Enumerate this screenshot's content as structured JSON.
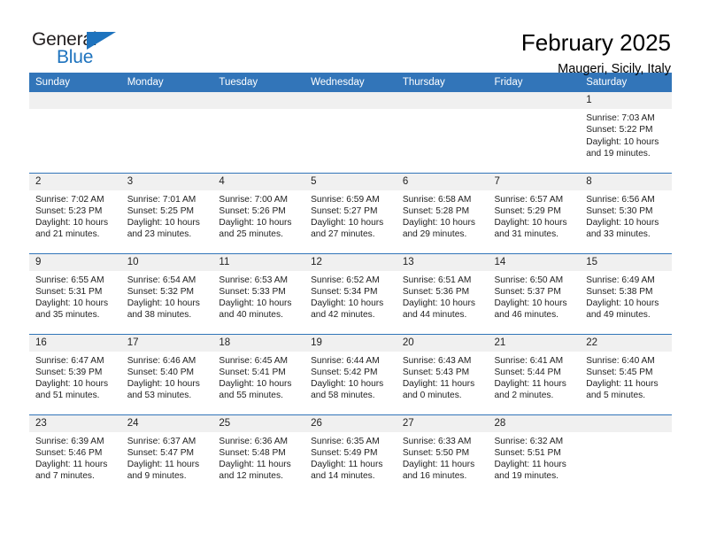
{
  "logo": {
    "primary_text": "General",
    "secondary_text": "Blue",
    "primary_color": "#231f20",
    "accent_color": "#1e73be",
    "triangle_icon": "triangle-icon"
  },
  "header": {
    "month_title": "February 2025",
    "location": "Maugeri, Sicily, Italy"
  },
  "theme": {
    "header_bg": "#3275b9",
    "header_text": "#ffffff",
    "daynum_bg": "#f0f0f0",
    "grid_line": "#3275b9",
    "body_text": "#222222"
  },
  "calendar": {
    "weekday_headers": [
      "Sunday",
      "Monday",
      "Tuesday",
      "Wednesday",
      "Thursday",
      "Friday",
      "Saturday"
    ],
    "weeks": [
      [
        {
          "day": "",
          "sunrise": "",
          "sunset": "",
          "daylight_line1": "",
          "daylight_line2": "",
          "empty": true
        },
        {
          "day": "",
          "sunrise": "",
          "sunset": "",
          "daylight_line1": "",
          "daylight_line2": "",
          "empty": true
        },
        {
          "day": "",
          "sunrise": "",
          "sunset": "",
          "daylight_line1": "",
          "daylight_line2": "",
          "empty": true
        },
        {
          "day": "",
          "sunrise": "",
          "sunset": "",
          "daylight_line1": "",
          "daylight_line2": "",
          "empty": true
        },
        {
          "day": "",
          "sunrise": "",
          "sunset": "",
          "daylight_line1": "",
          "daylight_line2": "",
          "empty": true
        },
        {
          "day": "",
          "sunrise": "",
          "sunset": "",
          "daylight_line1": "",
          "daylight_line2": "",
          "empty": true
        },
        {
          "day": "1",
          "sunrise": "Sunrise: 7:03 AM",
          "sunset": "Sunset: 5:22 PM",
          "daylight_line1": "Daylight: 10 hours",
          "daylight_line2": "and 19 minutes.",
          "empty": false
        }
      ],
      [
        {
          "day": "2",
          "sunrise": "Sunrise: 7:02 AM",
          "sunset": "Sunset: 5:23 PM",
          "daylight_line1": "Daylight: 10 hours",
          "daylight_line2": "and 21 minutes.",
          "empty": false
        },
        {
          "day": "3",
          "sunrise": "Sunrise: 7:01 AM",
          "sunset": "Sunset: 5:25 PM",
          "daylight_line1": "Daylight: 10 hours",
          "daylight_line2": "and 23 minutes.",
          "empty": false
        },
        {
          "day": "4",
          "sunrise": "Sunrise: 7:00 AM",
          "sunset": "Sunset: 5:26 PM",
          "daylight_line1": "Daylight: 10 hours",
          "daylight_line2": "and 25 minutes.",
          "empty": false
        },
        {
          "day": "5",
          "sunrise": "Sunrise: 6:59 AM",
          "sunset": "Sunset: 5:27 PM",
          "daylight_line1": "Daylight: 10 hours",
          "daylight_line2": "and 27 minutes.",
          "empty": false
        },
        {
          "day": "6",
          "sunrise": "Sunrise: 6:58 AM",
          "sunset": "Sunset: 5:28 PM",
          "daylight_line1": "Daylight: 10 hours",
          "daylight_line2": "and 29 minutes.",
          "empty": false
        },
        {
          "day": "7",
          "sunrise": "Sunrise: 6:57 AM",
          "sunset": "Sunset: 5:29 PM",
          "daylight_line1": "Daylight: 10 hours",
          "daylight_line2": "and 31 minutes.",
          "empty": false
        },
        {
          "day": "8",
          "sunrise": "Sunrise: 6:56 AM",
          "sunset": "Sunset: 5:30 PM",
          "daylight_line1": "Daylight: 10 hours",
          "daylight_line2": "and 33 minutes.",
          "empty": false
        }
      ],
      [
        {
          "day": "9",
          "sunrise": "Sunrise: 6:55 AM",
          "sunset": "Sunset: 5:31 PM",
          "daylight_line1": "Daylight: 10 hours",
          "daylight_line2": "and 35 minutes.",
          "empty": false
        },
        {
          "day": "10",
          "sunrise": "Sunrise: 6:54 AM",
          "sunset": "Sunset: 5:32 PM",
          "daylight_line1": "Daylight: 10 hours",
          "daylight_line2": "and 38 minutes.",
          "empty": false
        },
        {
          "day": "11",
          "sunrise": "Sunrise: 6:53 AM",
          "sunset": "Sunset: 5:33 PM",
          "daylight_line1": "Daylight: 10 hours",
          "daylight_line2": "and 40 minutes.",
          "empty": false
        },
        {
          "day": "12",
          "sunrise": "Sunrise: 6:52 AM",
          "sunset": "Sunset: 5:34 PM",
          "daylight_line1": "Daylight: 10 hours",
          "daylight_line2": "and 42 minutes.",
          "empty": false
        },
        {
          "day": "13",
          "sunrise": "Sunrise: 6:51 AM",
          "sunset": "Sunset: 5:36 PM",
          "daylight_line1": "Daylight: 10 hours",
          "daylight_line2": "and 44 minutes.",
          "empty": false
        },
        {
          "day": "14",
          "sunrise": "Sunrise: 6:50 AM",
          "sunset": "Sunset: 5:37 PM",
          "daylight_line1": "Daylight: 10 hours",
          "daylight_line2": "and 46 minutes.",
          "empty": false
        },
        {
          "day": "15",
          "sunrise": "Sunrise: 6:49 AM",
          "sunset": "Sunset: 5:38 PM",
          "daylight_line1": "Daylight: 10 hours",
          "daylight_line2": "and 49 minutes.",
          "empty": false
        }
      ],
      [
        {
          "day": "16",
          "sunrise": "Sunrise: 6:47 AM",
          "sunset": "Sunset: 5:39 PM",
          "daylight_line1": "Daylight: 10 hours",
          "daylight_line2": "and 51 minutes.",
          "empty": false
        },
        {
          "day": "17",
          "sunrise": "Sunrise: 6:46 AM",
          "sunset": "Sunset: 5:40 PM",
          "daylight_line1": "Daylight: 10 hours",
          "daylight_line2": "and 53 minutes.",
          "empty": false
        },
        {
          "day": "18",
          "sunrise": "Sunrise: 6:45 AM",
          "sunset": "Sunset: 5:41 PM",
          "daylight_line1": "Daylight: 10 hours",
          "daylight_line2": "and 55 minutes.",
          "empty": false
        },
        {
          "day": "19",
          "sunrise": "Sunrise: 6:44 AM",
          "sunset": "Sunset: 5:42 PM",
          "daylight_line1": "Daylight: 10 hours",
          "daylight_line2": "and 58 minutes.",
          "empty": false
        },
        {
          "day": "20",
          "sunrise": "Sunrise: 6:43 AM",
          "sunset": "Sunset: 5:43 PM",
          "daylight_line1": "Daylight: 11 hours",
          "daylight_line2": "and 0 minutes.",
          "empty": false
        },
        {
          "day": "21",
          "sunrise": "Sunrise: 6:41 AM",
          "sunset": "Sunset: 5:44 PM",
          "daylight_line1": "Daylight: 11 hours",
          "daylight_line2": "and 2 minutes.",
          "empty": false
        },
        {
          "day": "22",
          "sunrise": "Sunrise: 6:40 AM",
          "sunset": "Sunset: 5:45 PM",
          "daylight_line1": "Daylight: 11 hours",
          "daylight_line2": "and 5 minutes.",
          "empty": false
        }
      ],
      [
        {
          "day": "23",
          "sunrise": "Sunrise: 6:39 AM",
          "sunset": "Sunset: 5:46 PM",
          "daylight_line1": "Daylight: 11 hours",
          "daylight_line2": "and 7 minutes.",
          "empty": false
        },
        {
          "day": "24",
          "sunrise": "Sunrise: 6:37 AM",
          "sunset": "Sunset: 5:47 PM",
          "daylight_line1": "Daylight: 11 hours",
          "daylight_line2": "and 9 minutes.",
          "empty": false
        },
        {
          "day": "25",
          "sunrise": "Sunrise: 6:36 AM",
          "sunset": "Sunset: 5:48 PM",
          "daylight_line1": "Daylight: 11 hours",
          "daylight_line2": "and 12 minutes.",
          "empty": false
        },
        {
          "day": "26",
          "sunrise": "Sunrise: 6:35 AM",
          "sunset": "Sunset: 5:49 PM",
          "daylight_line1": "Daylight: 11 hours",
          "daylight_line2": "and 14 minutes.",
          "empty": false
        },
        {
          "day": "27",
          "sunrise": "Sunrise: 6:33 AM",
          "sunset": "Sunset: 5:50 PM",
          "daylight_line1": "Daylight: 11 hours",
          "daylight_line2": "and 16 minutes.",
          "empty": false
        },
        {
          "day": "28",
          "sunrise": "Sunrise: 6:32 AM",
          "sunset": "Sunset: 5:51 PM",
          "daylight_line1": "Daylight: 11 hours",
          "daylight_line2": "and 19 minutes.",
          "empty": false
        },
        {
          "day": "",
          "sunrise": "",
          "sunset": "",
          "daylight_line1": "",
          "daylight_line2": "",
          "empty": true
        }
      ]
    ]
  }
}
